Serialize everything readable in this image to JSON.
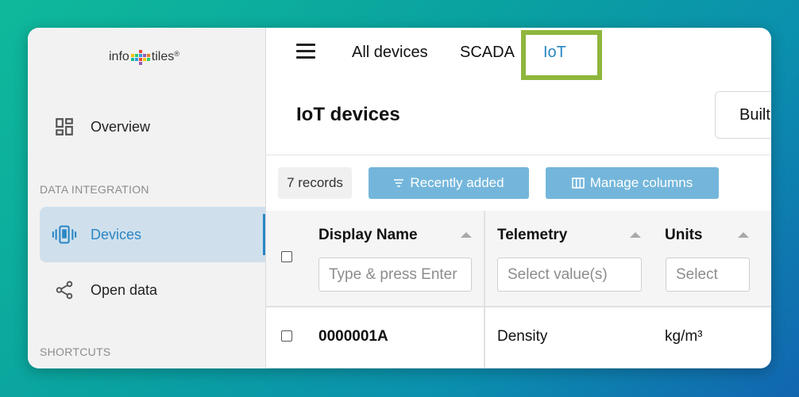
{
  "logo": {
    "left": "info",
    "right": "tiles",
    "mark": "®"
  },
  "sidebar": {
    "items": [
      {
        "label": "Overview",
        "icon": "dashboard-icon"
      },
      {
        "label": "Devices",
        "icon": "devices-icon",
        "active": true
      },
      {
        "label": "Open data",
        "icon": "share-icon"
      }
    ],
    "sections": [
      "DATA INTEGRATION",
      "SHORTCUTS"
    ]
  },
  "topnav": {
    "tabs": [
      {
        "label": "All devices"
      },
      {
        "label": "SCADA"
      },
      {
        "label": "IoT",
        "active": true
      }
    ]
  },
  "page": {
    "title": "IoT devices",
    "built_button": "Built"
  },
  "toolbar": {
    "records": "7 records",
    "sort_button": "Recently added",
    "columns_button": "Manage columns"
  },
  "table": {
    "columns": [
      {
        "header": "Display Name",
        "placeholder": "Type & press Enter"
      },
      {
        "header": "Telemetry",
        "placeholder": "Select value(s)"
      },
      {
        "header": "Units",
        "placeholder": "Select"
      }
    ],
    "rows": [
      {
        "display_name": "0000001A",
        "telemetry": "Density",
        "units": "kg/m³"
      }
    ]
  },
  "colors": {
    "accent": "#2a86c4",
    "button": "#74b6db",
    "highlight": "#8fb63c"
  }
}
